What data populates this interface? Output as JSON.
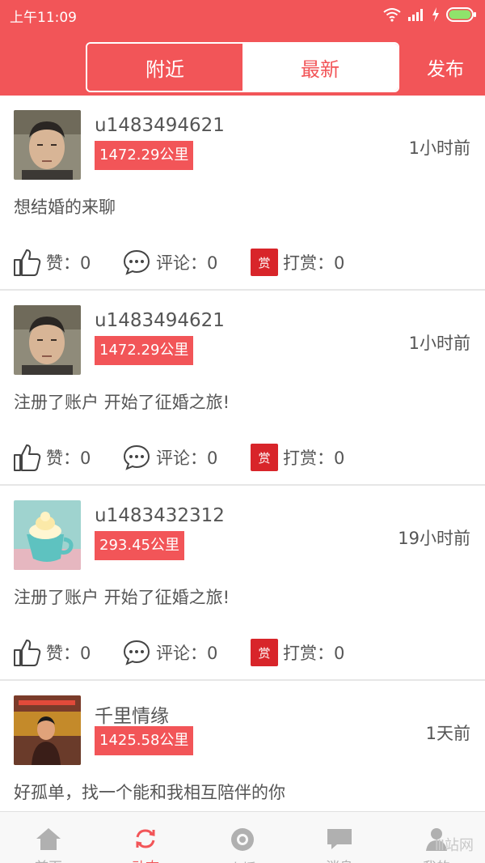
{
  "status_bar": {
    "time": "上午11:09"
  },
  "header": {
    "tabs": [
      {
        "label": "附近",
        "active": true
      },
      {
        "label": "最新",
        "active": false
      }
    ],
    "publish_label": "发布"
  },
  "posts": [
    {
      "username": "u1483494621",
      "distance": "1472.29公里",
      "time": "1小时前",
      "content": "想结婚的来聊",
      "likes_label": "赞：0",
      "comments_label": "评论：0",
      "reward_badge": "赏",
      "reward_label": "打赏：0"
    },
    {
      "username": "u1483494621",
      "distance": "1472.29公里",
      "time": "1小时前",
      "content": "注册了账户 开始了征婚之旅!",
      "likes_label": "赞：0",
      "comments_label": "评论：0",
      "reward_badge": "赏",
      "reward_label": "打赏：0"
    },
    {
      "username": "u1483432312",
      "distance": "293.45公里",
      "time": "19小时前",
      "content": "注册了账户 开始了征婚之旅!",
      "likes_label": "赞：0",
      "comments_label": "评论：0",
      "reward_badge": "赏",
      "reward_label": "打赏：0"
    },
    {
      "username": "千里情缘",
      "distance": "1425.58公里",
      "time": "1天前",
      "content": "好孤单，找一个能和我相互陪伴的你"
    }
  ],
  "bottom_nav": [
    {
      "label": "首页",
      "icon": "home-icon",
      "active": false
    },
    {
      "label": "动态",
      "icon": "refresh-icon",
      "active": true
    },
    {
      "label": "直播",
      "icon": "camera-icon",
      "active": false
    },
    {
      "label": "消息",
      "icon": "message-icon",
      "active": false
    },
    {
      "label": "我的",
      "icon": "user-icon",
      "active": false
    }
  ],
  "watermark": "Ⅲ站网",
  "colors": {
    "accent": "#f25558",
    "reward": "#d8252a",
    "divider": "#e6e6e6"
  }
}
